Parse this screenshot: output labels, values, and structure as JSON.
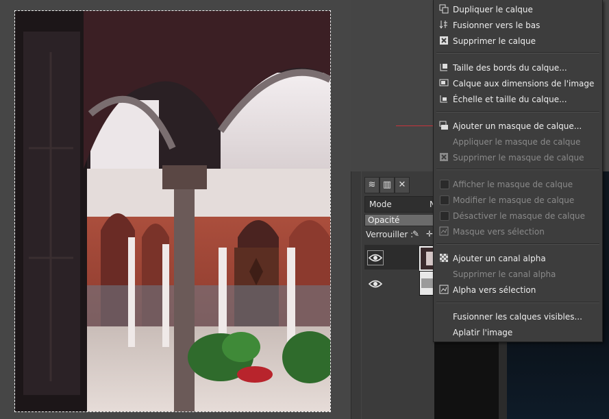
{
  "menu": {
    "items": [
      {
        "label": "Dupliquer le calque",
        "icon": "duplicate-layer-icon",
        "enabled": true
      },
      {
        "label": "Fusionner vers le bas",
        "icon": "merge-down-icon",
        "enabled": true
      },
      {
        "label": "Supprimer le calque",
        "icon": "delete-layer-icon",
        "enabled": true
      },
      {
        "label": "Taille des bords du calque...",
        "icon": "layer-boundary-size-icon",
        "enabled": true
      },
      {
        "label": "Calque aux dimensions de l'image",
        "icon": "layer-to-image-size-icon",
        "enabled": true
      },
      {
        "label": "Échelle et taille du calque...",
        "icon": "scale-layer-icon",
        "enabled": true
      },
      {
        "label": "Ajouter un masque de calque...",
        "icon": "add-layer-mask-icon",
        "enabled": true
      },
      {
        "label": "Appliquer le masque de calque",
        "icon": "",
        "enabled": false
      },
      {
        "label": "Supprimer le masque de calque",
        "icon": "delete-mask-icon",
        "enabled": false
      },
      {
        "label": "Afficher le masque de calque",
        "icon": "checkbox",
        "enabled": false
      },
      {
        "label": "Modifier le masque de calque",
        "icon": "checkbox",
        "enabled": false
      },
      {
        "label": "Désactiver le masque de calque",
        "icon": "checkbox",
        "enabled": false
      },
      {
        "label": "Masque vers sélection",
        "icon": "mask-to-selection-icon",
        "enabled": false
      },
      {
        "label": "Ajouter un canal alpha",
        "icon": "alpha-channel-icon",
        "enabled": true
      },
      {
        "label": "Supprimer le canal alpha",
        "icon": "",
        "enabled": false
      },
      {
        "label": "Alpha vers sélection",
        "icon": "alpha-to-selection-icon",
        "enabled": true
      },
      {
        "label": "Fusionner les calques visibles...",
        "icon": "",
        "enabled": true
      },
      {
        "label": "Aplatir l'image",
        "icon": "",
        "enabled": true
      }
    ]
  },
  "dock": {
    "tabs": [
      {
        "name": "layers-tab-icon",
        "glyph": "≋"
      },
      {
        "name": "channels-tab-icon",
        "glyph": "▥"
      },
      {
        "name": "paths-tab-icon",
        "glyph": "✕"
      }
    ],
    "mode_label": "Mode",
    "mode_value": "N",
    "opacity_label": "Opacité",
    "lock_label": "Verrouiller :",
    "lock_brush_glyph": "✎",
    "lock_move_glyph": "✛"
  },
  "colors": {
    "menu_bg": "#3d3d3d",
    "accent_line": "#c8353b"
  }
}
